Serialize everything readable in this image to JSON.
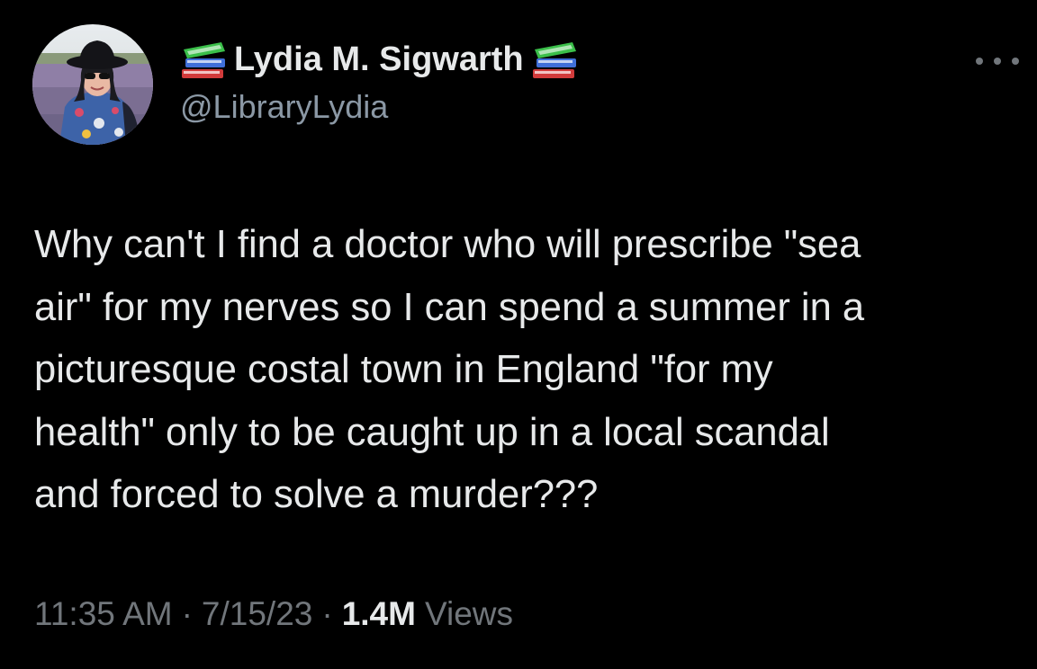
{
  "author": {
    "display_name": "Lydia M. Sigwarth",
    "handle": "@LibraryLydia",
    "name_prefix_icon": "books-icon",
    "name_suffix_icon": "books-icon"
  },
  "menu": {
    "icon": "more-horizontal-icon"
  },
  "tweet": {
    "text": "Why can't I find a doctor who will prescribe \"sea\nair\" for my nerves so I can spend a summer in a\npicturesque costal town in England \"for my\nhealth\" only to be caught up in a local scandal\nand forced to solve a murder???"
  },
  "meta": {
    "time": "11:35 AM",
    "separator": "·",
    "date": "7/15/23",
    "views_count": "1.4M",
    "views_label": "Views"
  },
  "colors": {
    "background": "#000000",
    "primary_text": "#e7e9ea",
    "secondary_text": "#71767b"
  }
}
